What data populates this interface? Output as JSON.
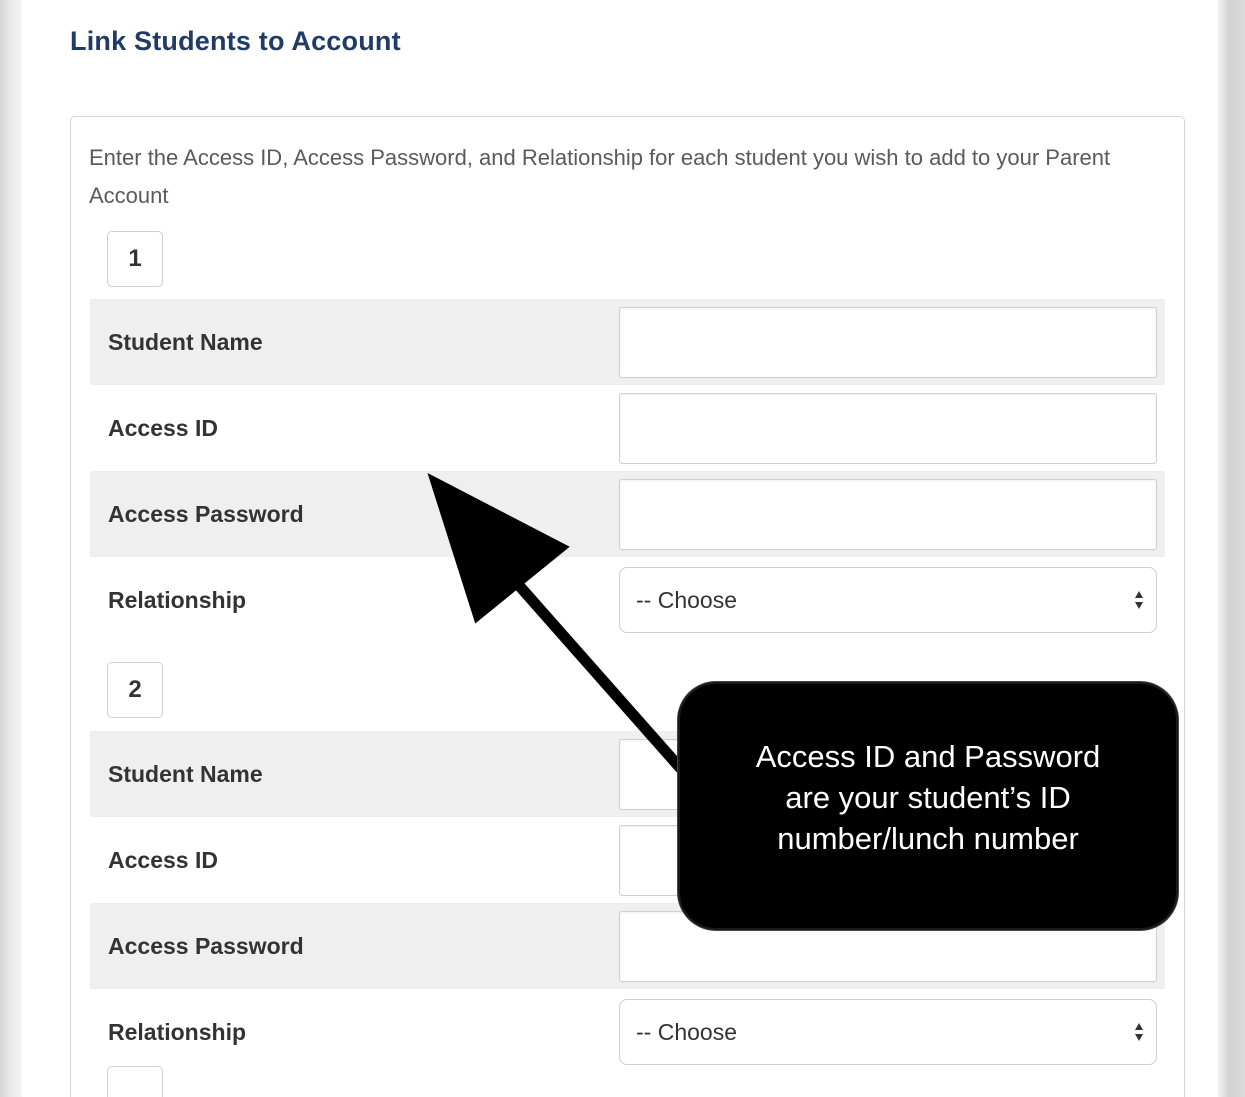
{
  "page_title": "Link Students to Account",
  "instructions": "Enter the Access ID, Access Password, and Relationship for each student you wish to add to your Parent Account",
  "students": [
    {
      "number": "1",
      "fields": {
        "student_name_label": "Student Name",
        "student_name_value": "",
        "access_id_label": "Access ID",
        "access_id_value": "",
        "access_password_label": "Access Password",
        "access_password_value": "",
        "relationship_label": "Relationship",
        "relationship_value": "-- Choose"
      }
    },
    {
      "number": "2",
      "fields": {
        "student_name_label": "Student Name",
        "student_name_value": "",
        "access_id_label": "Access ID",
        "access_id_value": "",
        "access_password_label": "Access Password",
        "access_password_value": "",
        "relationship_label": "Relationship",
        "relationship_value": "-- Choose"
      }
    }
  ],
  "callout": {
    "text": "Access ID and Password\nare your student’s ID\nnumber/lunch number"
  },
  "colors": {
    "title": "#1f3b66",
    "row_shade": "#efefef",
    "callout_bg": "#000000",
    "callout_text": "#ffffff"
  },
  "icons": {
    "select_arrows": "up-down-chevron-icon",
    "annotation_arrow": "arrow-icon"
  }
}
